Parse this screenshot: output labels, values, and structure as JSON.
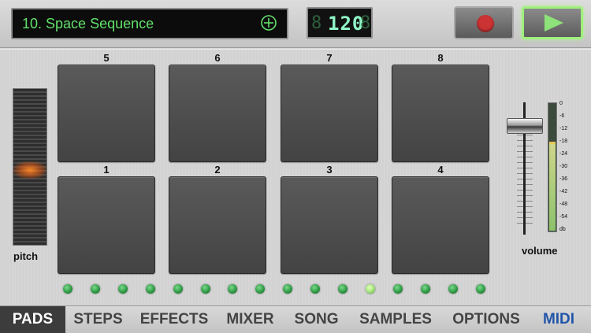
{
  "header": {
    "song_title": "10. Space Sequence",
    "bpm": "120",
    "bpm_ghost_left": "8",
    "bpm_ghost_right": "8",
    "add_icon": "plus-circle-icon",
    "record_icon": "record-dot-icon",
    "play_icon": "play-triangle-icon"
  },
  "pitch": {
    "label": "pitch",
    "level": 0.5
  },
  "pads": [
    {
      "number": "5"
    },
    {
      "number": "6"
    },
    {
      "number": "7"
    },
    {
      "number": "8"
    },
    {
      "number": "1"
    },
    {
      "number": "2"
    },
    {
      "number": "3"
    },
    {
      "number": "4"
    }
  ],
  "step_leds": {
    "count": 16,
    "active_index": 11
  },
  "volume": {
    "label": "volume",
    "level": 0.88,
    "meter_level": 0.68,
    "db_ticks": [
      "0",
      "-6",
      "-12",
      "-18",
      "-24",
      "-30",
      "-36",
      "-42",
      "-48",
      "-54",
      "db"
    ]
  },
  "tabs": [
    {
      "label": "PADS",
      "active": true
    },
    {
      "label": "STEPS",
      "active": false
    },
    {
      "label": "EFFECTS",
      "active": false
    },
    {
      "label": "MIXER",
      "active": false
    },
    {
      "label": "SONG",
      "active": false
    },
    {
      "label": "SAMPLES",
      "active": false
    },
    {
      "label": "OPTIONS",
      "active": false
    },
    {
      "label": "MIDI",
      "active": false
    }
  ],
  "colors": {
    "lcd_green": "#63e06b",
    "play_green": "#8ee27a",
    "record_red": "#cc3333",
    "midi_blue": "#2255aa"
  }
}
